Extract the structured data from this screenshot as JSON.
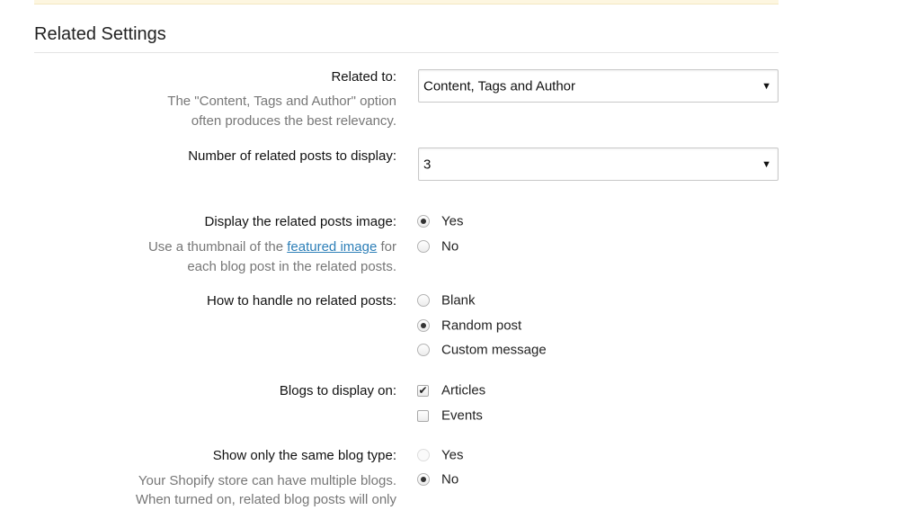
{
  "section": {
    "title": "Related Settings"
  },
  "related_to": {
    "label": "Related to:",
    "help_line1": "The \"Content, Tags and Author\" option",
    "help_line2": "often produces the best relevancy.",
    "selected": "Content, Tags and Author"
  },
  "num_posts": {
    "label": "Number of related posts to display:",
    "selected": "3"
  },
  "display_image": {
    "label": "Display the related posts image:",
    "help_line1_pre": "Use a thumbnail of the ",
    "help_link": "featured image",
    "help_line1_post": " for",
    "help_line2": "each blog post in the related posts.",
    "options": [
      {
        "label": "Yes",
        "checked": true
      },
      {
        "label": "No",
        "checked": false
      }
    ]
  },
  "no_related": {
    "label": "How to handle no related posts:",
    "options": [
      {
        "label": "Blank",
        "checked": false
      },
      {
        "label": "Random post",
        "checked": true
      },
      {
        "label": "Custom message",
        "checked": false
      }
    ]
  },
  "blogs_display": {
    "label": "Blogs to display on:",
    "options": [
      {
        "label": "Articles",
        "checked": true
      },
      {
        "label": "Events",
        "checked": false
      }
    ]
  },
  "same_blog_type": {
    "label": "Show only the same blog type:",
    "help_line1": "Your Shopify store can have multiple blogs.",
    "help_line2": "When turned on, related blog posts will only",
    "options": [
      {
        "label": "Yes",
        "checked": false,
        "disabled": true
      },
      {
        "label": "No",
        "checked": true
      }
    ]
  },
  "icons": {
    "dropdown_arrow": "▼",
    "check_mark": "✔"
  },
  "colors": {
    "link": "#2d7fb8",
    "help_text": "#777777",
    "banner": "#fdf6e0"
  }
}
